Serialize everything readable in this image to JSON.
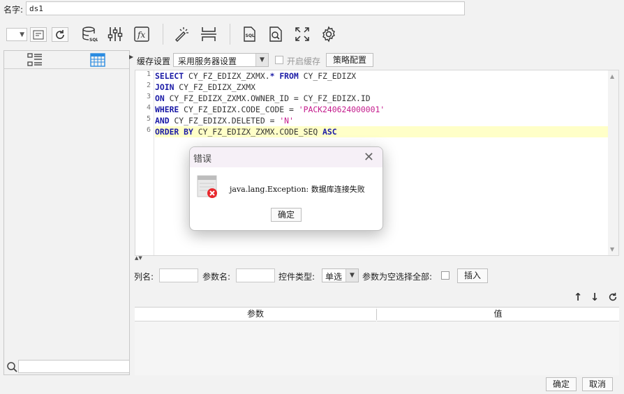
{
  "name_row": {
    "label": "名字:",
    "value": "ds1"
  },
  "toolbar": {
    "icons": [
      "dropdown-combo",
      "preview-icon",
      "refresh-icon",
      "database-sql-icon",
      "sliders-icon",
      "formula-icon",
      "magic-wand-icon",
      "page-break-icon",
      "sql-file-icon",
      "search-document-icon",
      "fullscreen-icon",
      "gear-icon"
    ]
  },
  "left_panel": {
    "tabs": [
      "list-view-icon",
      "calendar-view-icon"
    ]
  },
  "cache": {
    "label": "缓存设置",
    "select_value": "采用服务器设置",
    "check_label": "开启缓存",
    "policy_button": "策略配置"
  },
  "editor": {
    "line_numbers": [
      "1",
      "2",
      "3",
      "4",
      "5",
      "6"
    ],
    "lines": [
      [
        {
          "t": "SELECT ",
          "c": "kw"
        },
        {
          "t": "CY_FZ_EDIZX_ZXMX.",
          "c": ""
        },
        {
          "t": "* FROM ",
          "c": "kw"
        },
        {
          "t": "CY_FZ_EDIZX",
          "c": ""
        }
      ],
      [
        {
          "t": "JOIN ",
          "c": "kw"
        },
        {
          "t": "CY_FZ_EDIZX_ZXMX",
          "c": ""
        }
      ],
      [
        {
          "t": "ON ",
          "c": "kw"
        },
        {
          "t": "CY_FZ_EDIZX_ZXMX.OWNER_ID = CY_FZ_EDIZX.ID",
          "c": ""
        }
      ],
      [
        {
          "t": "WHERE ",
          "c": "kw"
        },
        {
          "t": "CY_FZ_EDIZX.CODE_CODE = ",
          "c": ""
        },
        {
          "t": "'PACK240624000001'",
          "c": "str"
        }
      ],
      [
        {
          "t": "AND ",
          "c": "kw"
        },
        {
          "t": "CY_FZ_EDIZX.DELETED = ",
          "c": ""
        },
        {
          "t": "'N'",
          "c": "str"
        }
      ],
      [
        {
          "t": "ORDER BY ",
          "c": "kw"
        },
        {
          "t": "CY_FZ_EDIZX_ZXMX.CODE_SEQ ",
          "c": ""
        },
        {
          "t": "ASC",
          "c": "kw"
        }
      ]
    ]
  },
  "params": {
    "col_name_label": "列名:",
    "param_name_label": "参数名:",
    "control_type_label": "控件类型:",
    "control_type_value": "单选",
    "empty_select_all_label": "参数为空选择全部:",
    "insert_button": "插入",
    "table_headers": [
      "参数",
      "值"
    ]
  },
  "footer": {
    "ok": "确定",
    "cancel": "取消"
  },
  "dialog": {
    "title": "错误",
    "message": "java.lang.Exception: 数据库连接失败",
    "ok": "确定"
  },
  "colors": {
    "keyword": "#1a1aa6",
    "string": "#c41a8c",
    "highlight": "#ffffc8",
    "error": "#e8282d"
  }
}
